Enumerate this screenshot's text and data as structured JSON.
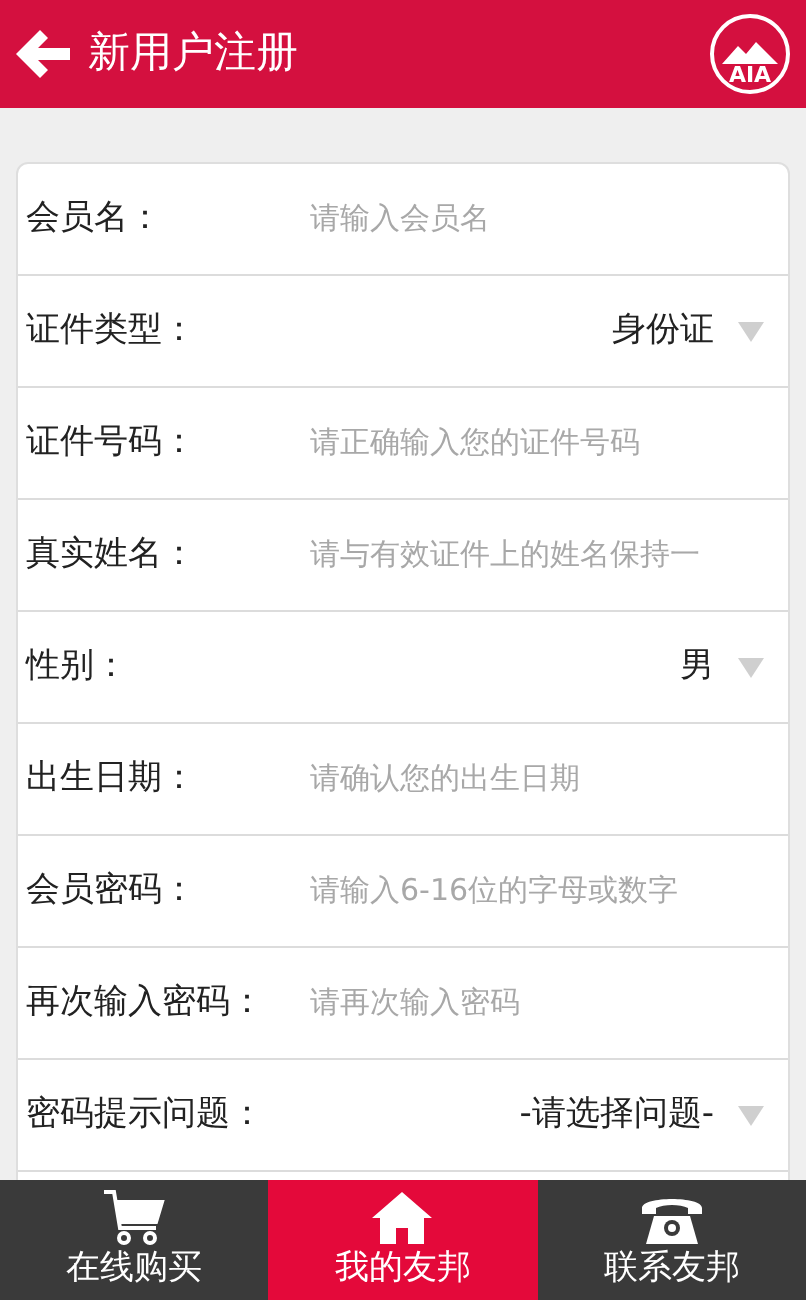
{
  "header": {
    "title": "新用户注册",
    "logo_text": "AIA"
  },
  "form": [
    {
      "kind": "input",
      "label": "会员名：",
      "placeholder": "请输入会员名"
    },
    {
      "kind": "select",
      "label": "证件类型：",
      "value": "身份证"
    },
    {
      "kind": "input",
      "label": "证件号码：",
      "placeholder": "请正确输入您的证件号码"
    },
    {
      "kind": "input",
      "label": "真实姓名：",
      "placeholder": "请与有效证件上的姓名保持一"
    },
    {
      "kind": "select",
      "label": "性别：",
      "value": "男"
    },
    {
      "kind": "input",
      "label": "出生日期：",
      "placeholder": "请确认您的出生日期"
    },
    {
      "kind": "input",
      "label": "会员密码：",
      "placeholder": "请输入6-16位的字母或数字"
    },
    {
      "kind": "input",
      "label": "再次输入密码：",
      "placeholder": "请再次输入密码"
    },
    {
      "kind": "select",
      "label": "密码提示问题：",
      "value": "-请选择问题-"
    }
  ],
  "tab_bar": [
    {
      "kind": "cart",
      "label": "在线购买",
      "selected": false
    },
    {
      "kind": "home",
      "label": "我的友邦",
      "selected": true
    },
    {
      "kind": "phone",
      "label": "联系友邦",
      "selected": false
    }
  ]
}
